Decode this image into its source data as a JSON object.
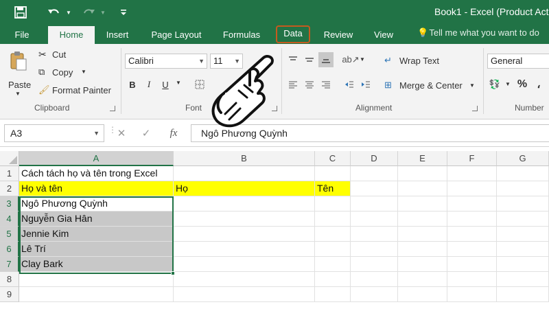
{
  "titlebar": {
    "title": "Book1 - Excel (Product Act",
    "qat": {
      "save_icon": "save-icon",
      "undo_icon": "undo-icon",
      "redo_icon": "redo-icon",
      "customize_icon": "customize-qat-icon"
    }
  },
  "tabs": [
    {
      "label": "File"
    },
    {
      "label": "Home"
    },
    {
      "label": "Insert"
    },
    {
      "label": "Page Layout"
    },
    {
      "label": "Formulas"
    },
    {
      "label": "Data"
    },
    {
      "label": "Review"
    },
    {
      "label": "View"
    }
  ],
  "tell_me": "Tell me what you want to do",
  "ribbon": {
    "clipboard": {
      "paste": "Paste",
      "cut": "Cut",
      "copy": "Copy",
      "format_painter": "Format Painter",
      "label": "Clipboard"
    },
    "font": {
      "font_name": "Calibri",
      "font_size": "11",
      "bold": "B",
      "italic": "I",
      "underline": "U",
      "label": "Font"
    },
    "alignment": {
      "wrap_text": "Wrap Text",
      "merge_center": "Merge & Center",
      "label": "Alignment"
    },
    "number": {
      "format": "General",
      "percent": "%",
      "label": "Number"
    }
  },
  "formula_bar": {
    "name_box": "A3",
    "fx": "fx",
    "value": "Ngô Phương Quỳnh"
  },
  "columns": [
    "A",
    "B",
    "C",
    "D",
    "E",
    "F",
    "G"
  ],
  "rows": [
    "1",
    "2",
    "3",
    "4",
    "5",
    "6",
    "7",
    "8",
    "9"
  ],
  "cells": {
    "A1": "Cách tách họ và tên trong Excel",
    "A2": "Họ và tên",
    "B2": "Họ",
    "C2": "Tên",
    "A3": "Ngô Phương Quỳnh",
    "A4": "Nguyễn Gia Hân",
    "A5": "Jennie Kim",
    "A6": "Lê Trí",
    "A7": "Clay Bark"
  },
  "colors": {
    "excel_green": "#217346",
    "highlight_outline": "#c65a1e",
    "header_fill": "#ffff00",
    "selection_fill": "#c8c8c8"
  }
}
